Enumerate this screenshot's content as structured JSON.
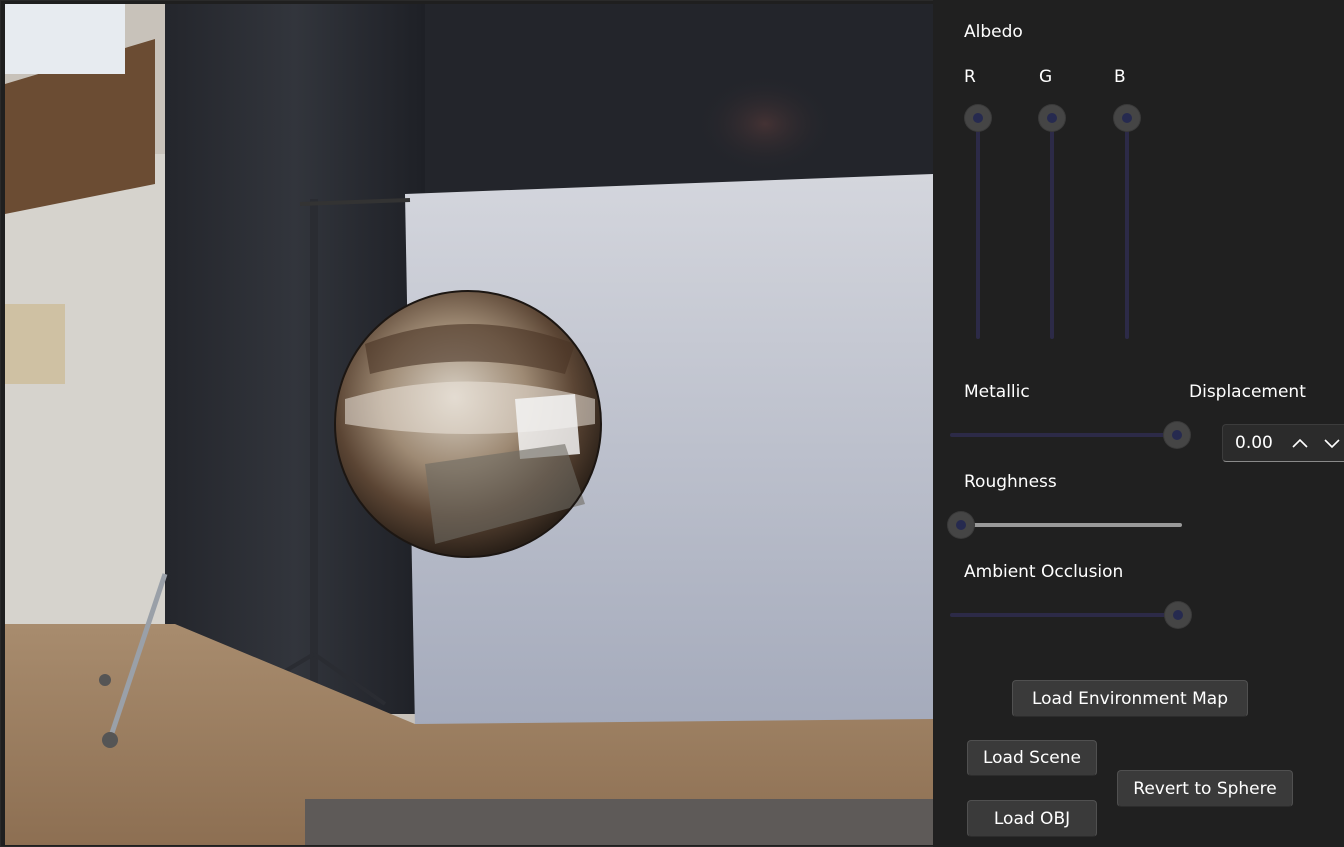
{
  "albedo": {
    "title": "Albedo",
    "channels": [
      {
        "label": "R",
        "value": 1.0
      },
      {
        "label": "G",
        "value": 1.0
      },
      {
        "label": "B",
        "value": 1.0
      }
    ]
  },
  "metallic": {
    "label": "Metallic",
    "value": 1.0
  },
  "roughness": {
    "label": "Roughness",
    "value": 0.0
  },
  "ambient_occlusion": {
    "label": "Ambient Occlusion",
    "value": 1.0
  },
  "displacement": {
    "label": "Displacement",
    "value": "0.00",
    "up_icon": "chevron-up-icon",
    "down_icon": "chevron-down-icon"
  },
  "buttons": {
    "load_env": "Load Environment Map",
    "load_scene": "Load Scene",
    "load_obj": "Load OBJ",
    "revert": "Revert to Sphere"
  },
  "colors": {
    "panel_bg": "#202020",
    "slider_track": "#2c2a47",
    "roughness_track": "#9a9a9a",
    "button_bg": "#3a3a3a"
  }
}
